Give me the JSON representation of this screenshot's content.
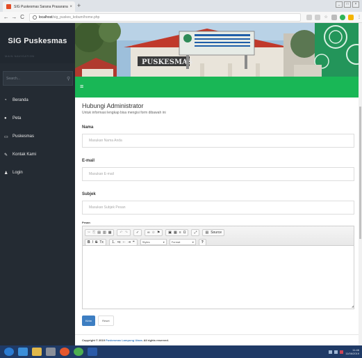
{
  "browser": {
    "tab_title": "SIG Puskesmas Sarana Prasarana",
    "tab_close": "×",
    "new_tab": "+",
    "url_host": "localhost",
    "url_path": "/sig_puskes_kobum/home.php",
    "back": "←",
    "forward": "→",
    "reload": "C",
    "window_minimize": "_",
    "window_restore": "□",
    "window_close": "×"
  },
  "sidebar": {
    "brand": "SIG Puskesmas",
    "nav_label": "MAIN NAVIGATION",
    "search_placeholder": "Search...",
    "items": [
      {
        "label": "Beranda",
        "icon": "dashboard-icon",
        "glyph": "◔"
      },
      {
        "label": "Peta",
        "icon": "globe-icon",
        "glyph": "●"
      },
      {
        "label": "Puskesmas",
        "icon": "hospital-icon",
        "glyph": "▭"
      },
      {
        "label": "Kontak Kami",
        "icon": "edit-icon",
        "glyph": "✎"
      },
      {
        "label": "Login",
        "icon": "users-icon",
        "glyph": "♟"
      }
    ]
  },
  "banner": {
    "building_sign": "PUSKESMAS"
  },
  "form": {
    "title": "Hubungi Administrator",
    "subtitle": "Untuk informasi lengkap bisa mengisi form dibawah ini",
    "nama_label": "Nama",
    "nama_placeholder": "Masukan Nama Anda",
    "email_label": "E-mail",
    "email_placeholder": "Masukan E-mail",
    "subjek_label": "Subjek",
    "subjek_placeholder": "Masukan Subjek Pesan",
    "pesan_label": "Pesan",
    "submit_label": "Kirim",
    "reset_label": "Reset"
  },
  "editor": {
    "source_label": "Source",
    "styles_label": "Styles",
    "format_label": "Format",
    "help": "?"
  },
  "footer": {
    "prefix": "Copyright © 2019",
    "org": "Puskesmas Lampung Utara",
    "suffix": ". All rights reserved."
  },
  "taskbar": {
    "time": "11:46",
    "date": "11/06/2019"
  },
  "colors": {
    "sidebar_bg": "#242b33",
    "accent_green": "#19b756",
    "primary_button": "#3d7ec2"
  }
}
